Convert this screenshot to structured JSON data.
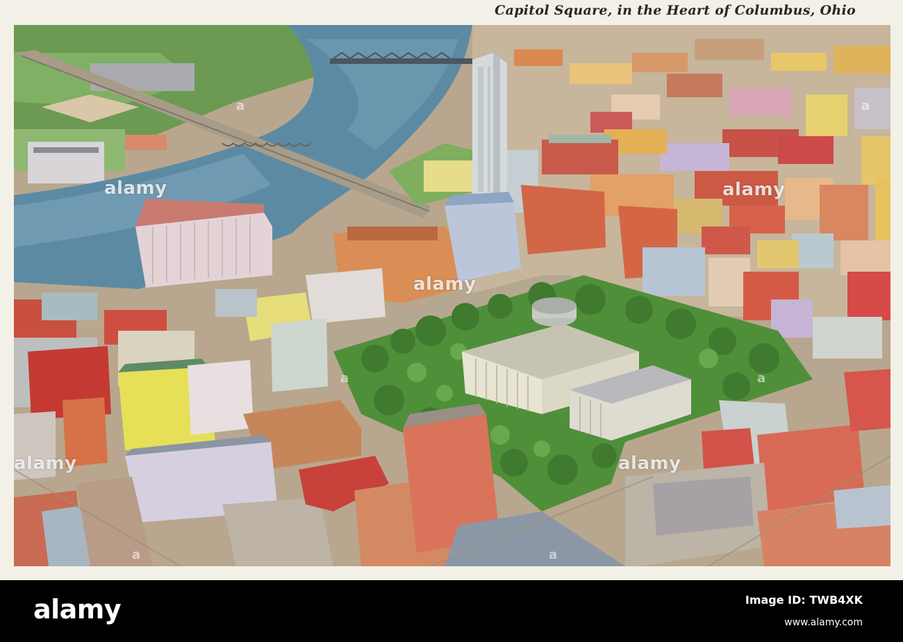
{
  "caption": "Capitol Square, in the Heart of Columbus, Ohio",
  "watermark": {
    "brand": "alamy",
    "small_mark": "a"
  },
  "footer": {
    "logo": "alamy",
    "image_id_label": "Image ID: TWB4XK",
    "site": "www.alamy.com"
  },
  "colors": {
    "river": "#5d8aa3",
    "park": "#4f8f3a",
    "capitol": "#d9d6c6",
    "tower": "#c9d4d6"
  }
}
